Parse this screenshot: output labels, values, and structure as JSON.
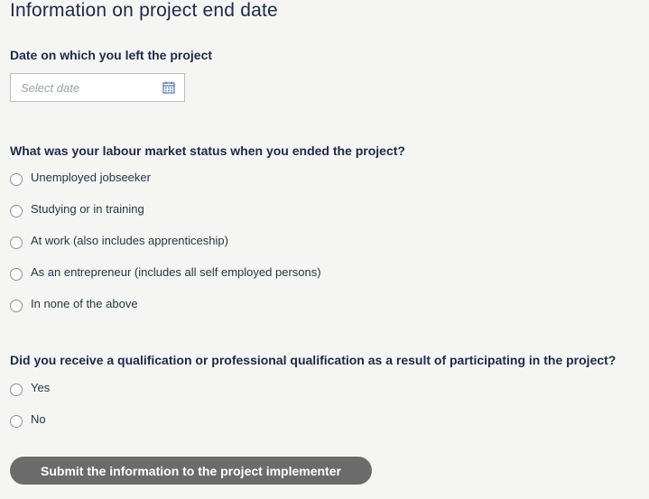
{
  "title": "Information on project end date",
  "date_section": {
    "label": "Date on which you left the project",
    "placeholder": "Select date"
  },
  "status_section": {
    "question": "What was your labour market status when you ended the project?",
    "options": [
      {
        "label": "Unemployed jobseeker",
        "selected": false
      },
      {
        "label": "Studying or in training",
        "selected": false
      },
      {
        "label": "At work (also includes apprenticeship)",
        "selected": false
      },
      {
        "label": "As an entrepreneur (includes all self employed persons)",
        "selected": false
      },
      {
        "label": "In none of the above",
        "selected": false
      }
    ]
  },
  "qualification_section": {
    "question": "Did you receive a qualification or professional qualification as a result of participating in the project?",
    "options": [
      {
        "label": "Yes",
        "selected": false
      },
      {
        "label": "No",
        "selected": false
      }
    ]
  },
  "submit": {
    "label": "Submit the information to the project implementer"
  },
  "colors": {
    "background": "#f5f5f4",
    "heading": "#1b2a4a",
    "button": "#6b6b6b",
    "button_text": "#ffffff"
  },
  "icons": {
    "date_picker": "calendar-icon"
  }
}
